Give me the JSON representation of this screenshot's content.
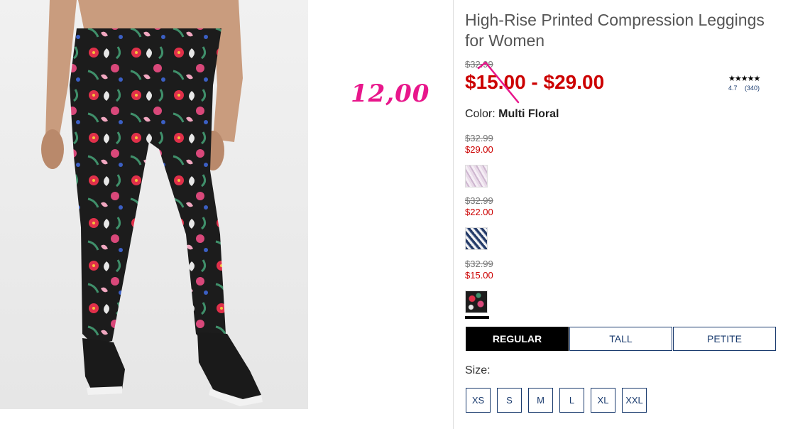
{
  "product": {
    "title": "High-Rise Printed Compression Leggings for Women",
    "was_price": "$32.99",
    "sale_range": "$15.00 - $29.00",
    "color_label": "Color:",
    "color_value": "Multi Floral"
  },
  "annotation": {
    "text": "12,00",
    "color": "#e8168b"
  },
  "rating": {
    "stars": "★★★★★",
    "score": "4.7",
    "count": "(340)"
  },
  "swatches": [
    {
      "old_price": "$32.99",
      "new_price": "$29.00",
      "pattern": "lavender-stripe"
    },
    {
      "old_price": "$32.99",
      "new_price": "$22.00",
      "pattern": "navy-diagonal-stripe"
    },
    {
      "old_price": "$32.99",
      "new_price": "$15.00",
      "pattern": "multi-floral",
      "selected": true
    }
  ],
  "fit_tabs": [
    "REGULAR",
    "TALL",
    "PETITE"
  ],
  "size": {
    "label": "Size:",
    "options": [
      "XS",
      "S",
      "M",
      "L",
      "XL",
      "XXL"
    ]
  },
  "colors": {
    "sale_red": "#cc0000",
    "navy": "#1a3b6e"
  }
}
